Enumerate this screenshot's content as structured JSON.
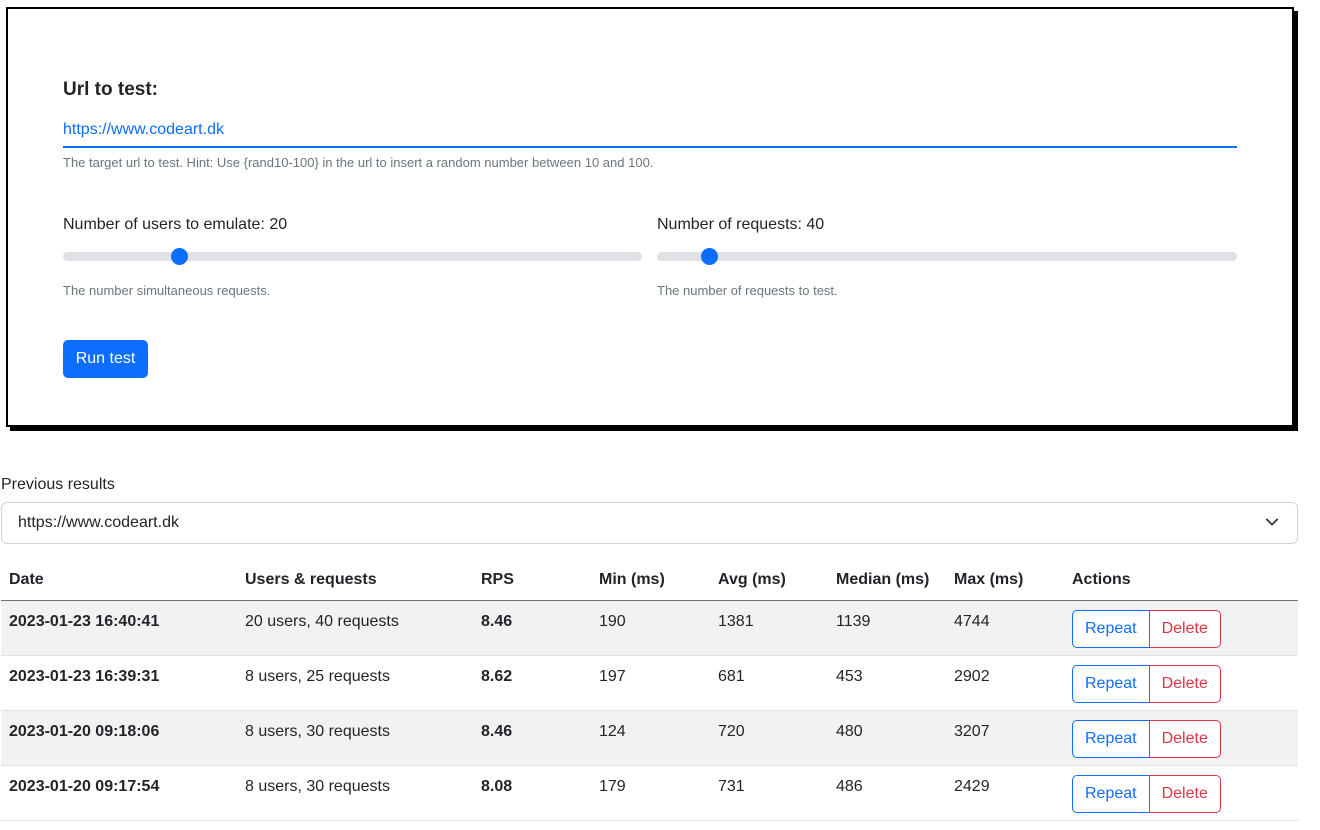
{
  "form": {
    "url_label": "Url to test:",
    "url_value": "https://www.codeart.dk",
    "url_hint": "The target url to test. Hint: Use {rand10-100} in the url to insert a random number between 10 and 100.",
    "users": {
      "label": "Number of users to emulate: 20",
      "value": 20,
      "fill_fraction": 0.2,
      "hint": "The number simultaneous requests."
    },
    "requests": {
      "label": "Number of requests: 40",
      "value": 40,
      "fill_fraction": 0.09,
      "hint": "The number of requests to test."
    },
    "run_label": "Run test"
  },
  "previous": {
    "label": "Previous results",
    "selected": "https://www.codeart.dk"
  },
  "table": {
    "headers": [
      "Date",
      "Users & requests",
      "RPS",
      "Min (ms)",
      "Avg (ms)",
      "Median (ms)",
      "Max (ms)",
      "Actions"
    ],
    "repeat_label": "Repeat",
    "delete_label": "Delete",
    "rows": [
      {
        "date": "2023-01-23 16:40:41",
        "users": "20 users, 40 requests",
        "rps": "8.46",
        "min": "190",
        "avg": "1381",
        "median": "1139",
        "max": "4744"
      },
      {
        "date": "2023-01-23 16:39:31",
        "users": "8 users, 25 requests",
        "rps": "8.62",
        "min": "197",
        "avg": "681",
        "median": "453",
        "max": "2902"
      },
      {
        "date": "2023-01-20 09:18:06",
        "users": "8 users, 30 requests",
        "rps": "8.46",
        "min": "124",
        "avg": "720",
        "median": "480",
        "max": "3207"
      },
      {
        "date": "2023-01-20 09:17:54",
        "users": "8 users, 30 requests",
        "rps": "8.08",
        "min": "179",
        "avg": "731",
        "median": "486",
        "max": "2429"
      }
    ]
  },
  "colors": {
    "primary": "#0d6efd",
    "danger": "#dc3545",
    "muted": "#6c757d"
  }
}
